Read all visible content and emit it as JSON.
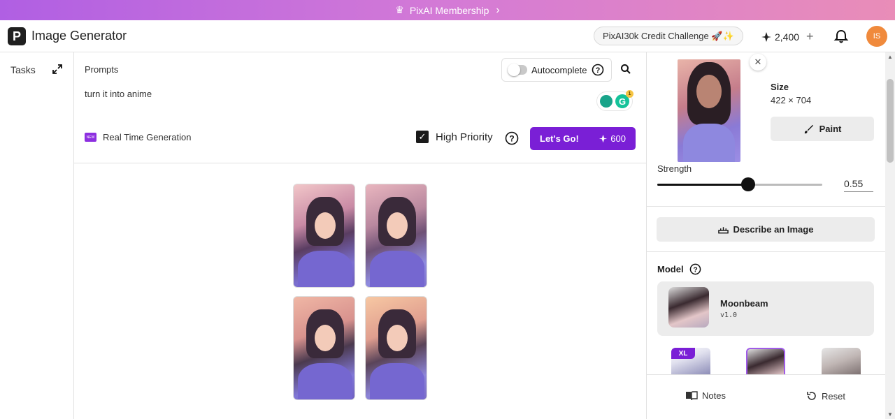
{
  "banner": {
    "label": "PixAI Membership"
  },
  "header": {
    "logo_letter": "P",
    "title": "Image Generator",
    "challenge": "PixAI30k Credit Challenge 🚀✨",
    "credits": "2,400",
    "avatar_initials": "IS"
  },
  "tasks": {
    "label": "Tasks"
  },
  "prompt": {
    "label": "Prompts",
    "autocomplete_label": "Autocomplete",
    "text": "turn it into anime",
    "realtime_badge": "NEW",
    "realtime_label": "Real Time Generation",
    "high_priority_label": "High Priority",
    "go_label": "Let's Go!",
    "go_cost": "600",
    "grammarly_count": "1",
    "grammarly_letter": "G"
  },
  "reference": {
    "size_label": "Size",
    "size_value": "422 × 704",
    "paint_label": "Paint",
    "strength_label": "Strength",
    "strength_value": "0.55",
    "strength_fraction": 0.55,
    "describe_label": "Describe an Image"
  },
  "model": {
    "label": "Model",
    "name": "Moonbeam",
    "version": "v1.0",
    "option_badge": "XL"
  },
  "footer": {
    "notes_label": "Notes",
    "reset_label": "Reset"
  },
  "colors": {
    "accent": "#7a1fd6",
    "banner_start": "#b05fe3",
    "banner_end": "#e98db8",
    "avatar": "#f08a3c"
  }
}
